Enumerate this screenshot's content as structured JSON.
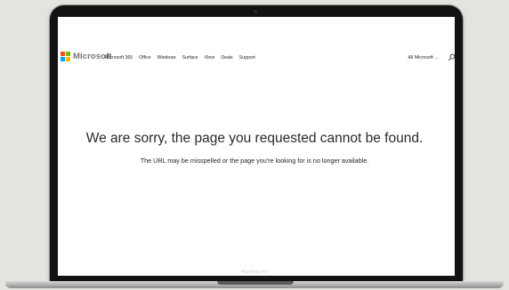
{
  "brand": {
    "name": "Microsoft",
    "colors": [
      "#f25022",
      "#7fba00",
      "#00a4ef",
      "#ffb900"
    ]
  },
  "nav": {
    "items": [
      "Microsoft 365",
      "Office",
      "Windows",
      "Surface",
      "Xbox",
      "Deals",
      "Support"
    ],
    "all_label": "All Microsoft",
    "all_chevron": "⌄"
  },
  "message": {
    "title": "We are sorry, the page you requested cannot be found.",
    "subtitle": "The URL may be misspelled or the page you're looking for is no longer available."
  },
  "device": {
    "label": "MacBook Pro"
  }
}
